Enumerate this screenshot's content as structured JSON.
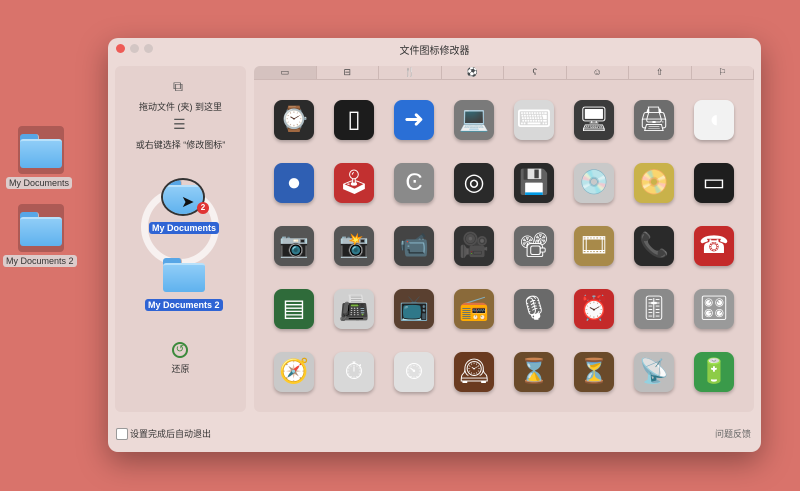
{
  "desktop": {
    "folders": [
      {
        "label": "My Documents"
      },
      {
        "label": "My Documents 2"
      }
    ]
  },
  "window": {
    "title": "文件图标修改器",
    "tabs": [
      {
        "icon": "display-icon",
        "glyph": "▭"
      },
      {
        "icon": "car-icon",
        "glyph": "⊟"
      },
      {
        "icon": "fork-knife-icon",
        "glyph": "🍴"
      },
      {
        "icon": "soccer-ball-icon",
        "glyph": "⚽"
      },
      {
        "icon": "teddy-bear-icon",
        "glyph": "ʕ"
      },
      {
        "icon": "smiley-icon",
        "glyph": "☺"
      },
      {
        "icon": "arrow-up-icon",
        "glyph": "⇧"
      },
      {
        "icon": "flag-icon",
        "glyph": "⚐"
      }
    ],
    "left_panel": {
      "drag_hint": "拖动文件 (夹) 到这里",
      "right_click_hint": "或右键选择 “修改图标”",
      "drag_folder_label": "My Documents",
      "drag_badge": "2",
      "drop_folder_label": "My Documents 2",
      "restore_label": "还原"
    },
    "icons": [
      {
        "name": "apple-watch-icon",
        "glyph": "⌚",
        "color": "#2b2b2b"
      },
      {
        "name": "iphone-icon",
        "glyph": "▯",
        "color": "#1c1c1c"
      },
      {
        "name": "iphone-transfer-icon",
        "glyph": "➜",
        "color": "#2a6fd6"
      },
      {
        "name": "macbook-icon",
        "glyph": "💻",
        "color": "#7a7a7a"
      },
      {
        "name": "keyboard-icon",
        "glyph": "⌨",
        "color": "#d8d8d8"
      },
      {
        "name": "imac-icon",
        "glyph": "🖥",
        "color": "#3b3b3b"
      },
      {
        "name": "printer-icon",
        "glyph": "🖨",
        "color": "#6d6d6d"
      },
      {
        "name": "mouse-icon",
        "glyph": "◖",
        "color": "#f2f2f2"
      },
      {
        "name": "trackball-icon",
        "glyph": "●",
        "color": "#2f5fb3"
      },
      {
        "name": "joystick-icon",
        "glyph": "🕹",
        "color": "#c23030"
      },
      {
        "name": "clamp-icon",
        "glyph": "Ͼ",
        "color": "#8a8a8a"
      },
      {
        "name": "disc-drive-icon",
        "glyph": "◎",
        "color": "#2a2a2a"
      },
      {
        "name": "floppy-disk-icon",
        "glyph": "💾",
        "color": "#2a2a2a"
      },
      {
        "name": "cd-icon",
        "glyph": "💿",
        "color": "#c9c9c9"
      },
      {
        "name": "dvd-icon",
        "glyph": "📀",
        "color": "#c9b24a"
      },
      {
        "name": "vhs-tape-icon",
        "glyph": "▭",
        "color": "#1e1e1e"
      },
      {
        "name": "camera-icon",
        "glyph": "📷",
        "color": "#555555"
      },
      {
        "name": "camera-flash-icon",
        "glyph": "📸",
        "color": "#555555"
      },
      {
        "name": "camcorder-icon",
        "glyph": "📹",
        "color": "#444444"
      },
      {
        "name": "movie-camera-icon",
        "glyph": "🎥",
        "color": "#333333"
      },
      {
        "name": "projector-icon",
        "glyph": "📽",
        "color": "#6a6a6a"
      },
      {
        "name": "film-strip-icon",
        "glyph": "🎞",
        "color": "#a88a4a"
      },
      {
        "name": "phone-receiver-icon",
        "glyph": "📞",
        "color": "#2a2a2a"
      },
      {
        "name": "telephone-icon",
        "glyph": "☎",
        "color": "#c42a2a"
      },
      {
        "name": "pager-icon",
        "glyph": "▤",
        "color": "#2f6b3a"
      },
      {
        "name": "fax-machine-icon",
        "glyph": "📠",
        "color": "#d0d0d0"
      },
      {
        "name": "television-icon",
        "glyph": "📺",
        "color": "#5a4030"
      },
      {
        "name": "radio-icon",
        "glyph": "📻",
        "color": "#8a6a3a"
      },
      {
        "name": "microphone-icon",
        "glyph": "🎙",
        "color": "#6a6a6a"
      },
      {
        "name": "alarm-clock-icon",
        "glyph": "⏰",
        "color": "#c42a2a"
      },
      {
        "name": "fader-icon",
        "glyph": "🎚",
        "color": "#8a8a8a"
      },
      {
        "name": "control-knobs-icon",
        "glyph": "🎛",
        "color": "#9a9a9a"
      },
      {
        "name": "compass-icon",
        "glyph": "🧭",
        "color": "#c9c9c9"
      },
      {
        "name": "stopwatch-icon",
        "glyph": "⏱",
        "color": "#d8d8d8"
      },
      {
        "name": "timer-icon",
        "glyph": "⏲",
        "color": "#e0e0e0"
      },
      {
        "name": "mantel-clock-icon",
        "glyph": "🕰",
        "color": "#6a3a20"
      },
      {
        "name": "hourglass-icon",
        "glyph": "⌛",
        "color": "#6a4a2a"
      },
      {
        "name": "hourglass-flowing-icon",
        "glyph": "⏳",
        "color": "#6a4a2a"
      },
      {
        "name": "satellite-dish-icon",
        "glyph": "📡",
        "color": "#bdbdbd"
      },
      {
        "name": "battery-icon",
        "glyph": "🔋",
        "color": "#3a9a4a"
      }
    ],
    "footer": {
      "auto_quit_label": "设置完成后自动退出",
      "feedback_label": "问题反馈"
    }
  }
}
